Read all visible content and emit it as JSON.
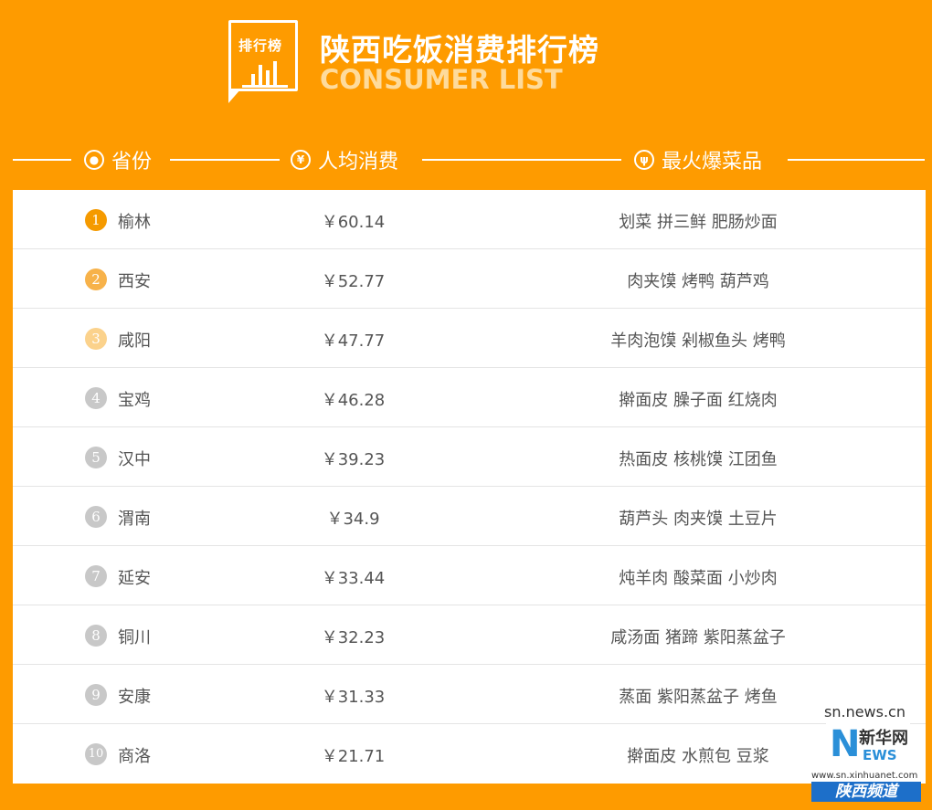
{
  "header": {
    "logo_label": "排行榜",
    "title": "陕西吃饭消费排行榜",
    "subtitle": "CONSUMER LIST"
  },
  "columns": {
    "province": "省份",
    "avg_spend": "人均消费",
    "hot_dishes": "最火爆菜品",
    "icons": [
      "location-pin-icon",
      "yuan-icon",
      "utensils-icon"
    ]
  },
  "colors": {
    "background": "#fe9b00",
    "rank1": "#f59a00",
    "rank2": "#f7b24a",
    "rank3": "#fbd28c",
    "rank_other": "#c8c8c8"
  },
  "rows": [
    {
      "rank": "1",
      "province": "榆林",
      "price": "￥60.14",
      "dishes": "划菜 拼三鲜 肥肠炒面"
    },
    {
      "rank": "2",
      "province": "西安",
      "price": "￥52.77",
      "dishes": "肉夹馍 烤鸭 葫芦鸡"
    },
    {
      "rank": "3",
      "province": "咸阳",
      "price": "￥47.77",
      "dishes": "羊肉泡馍 剁椒鱼头 烤鸭"
    },
    {
      "rank": "4",
      "province": "宝鸡",
      "price": "￥46.28",
      "dishes": "擀面皮 臊子面 红烧肉"
    },
    {
      "rank": "5",
      "province": "汉中",
      "price": "￥39.23",
      "dishes": "热面皮 核桃馍 江团鱼"
    },
    {
      "rank": "6",
      "province": "渭南",
      "price": "￥34.9",
      "dishes": "葫芦头 肉夹馍 土豆片"
    },
    {
      "rank": "7",
      "province": "延安",
      "price": "￥33.44",
      "dishes": "炖羊肉 酸菜面 小炒肉"
    },
    {
      "rank": "8",
      "province": "铜川",
      "price": "￥32.23",
      "dishes": "咸汤面 猪蹄 紫阳蒸盆子"
    },
    {
      "rank": "9",
      "province": "安康",
      "price": "￥31.33",
      "dishes": "蒸面 紫阳蒸盆子 烤鱼"
    },
    {
      "rank": "10",
      "province": "商洛",
      "price": "￥21.71",
      "dishes": "擀面皮 水煎包 豆浆"
    }
  ],
  "watermark": {
    "url": "sn.news.cn",
    "logo_cn": "新华网",
    "logo_letter": "N",
    "logo_ews": "EWS",
    "site": "www.sn.xinhuanet.com",
    "channel": "陕西频道"
  }
}
